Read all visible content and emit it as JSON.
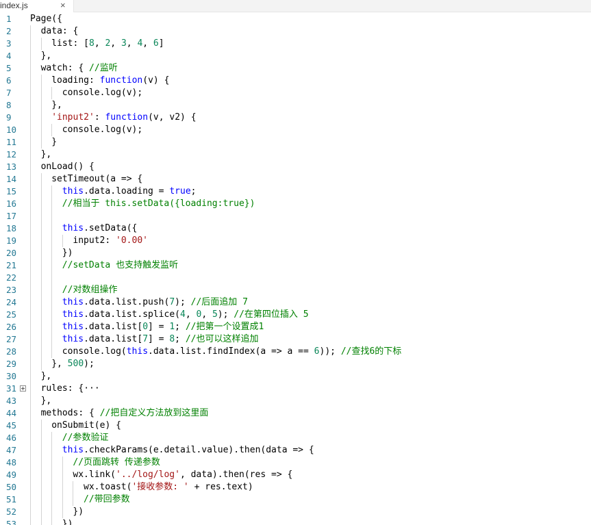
{
  "tab": {
    "title": "index.js",
    "close": "×"
  },
  "editor": {
    "fold_marker": "fold-expand-icon",
    "colors": {
      "keyword": "#0000ff",
      "comment": "#008000",
      "string": "#a31515",
      "number": "#098658",
      "linenumber": "#237893"
    },
    "lines": [
      {
        "n": "1",
        "indent": 0,
        "tokens": [
          [
            "Page({",
            ""
          ]
        ]
      },
      {
        "n": "2",
        "indent": 1,
        "tokens": [
          [
            "data: {",
            ""
          ]
        ]
      },
      {
        "n": "3",
        "indent": 2,
        "tokens": [
          [
            "list: [",
            ""
          ],
          [
            "8",
            "nm"
          ],
          [
            ", ",
            ""
          ],
          [
            "2",
            "nm"
          ],
          [
            ", ",
            ""
          ],
          [
            "3",
            "nm"
          ],
          [
            ", ",
            ""
          ],
          [
            "4",
            "nm"
          ],
          [
            ", ",
            ""
          ],
          [
            "6",
            "nm"
          ],
          [
            "]",
            ""
          ]
        ]
      },
      {
        "n": "4",
        "indent": 1,
        "tokens": [
          [
            "},",
            ""
          ]
        ]
      },
      {
        "n": "5",
        "indent": 1,
        "tokens": [
          [
            "watch: { ",
            ""
          ],
          [
            "//监听",
            "cm"
          ]
        ]
      },
      {
        "n": "6",
        "indent": 2,
        "tokens": [
          [
            "loading: ",
            ""
          ],
          [
            "function",
            "kw"
          ],
          [
            "(v) {",
            ""
          ]
        ]
      },
      {
        "n": "7",
        "indent": 3,
        "tokens": [
          [
            "console.log(v);",
            ""
          ]
        ]
      },
      {
        "n": "8",
        "indent": 2,
        "tokens": [
          [
            "},",
            ""
          ]
        ]
      },
      {
        "n": "9",
        "indent": 2,
        "tokens": [
          [
            "'input2'",
            "st"
          ],
          [
            ": ",
            ""
          ],
          [
            "function",
            "kw"
          ],
          [
            "(v, v2) {",
            ""
          ]
        ]
      },
      {
        "n": "10",
        "indent": 3,
        "tokens": [
          [
            "console.log(v);",
            ""
          ]
        ]
      },
      {
        "n": "11",
        "indent": 2,
        "tokens": [
          [
            "}",
            ""
          ]
        ]
      },
      {
        "n": "12",
        "indent": 1,
        "tokens": [
          [
            "},",
            ""
          ]
        ]
      },
      {
        "n": "13",
        "indent": 1,
        "tokens": [
          [
            "onLoad() {",
            ""
          ]
        ]
      },
      {
        "n": "14",
        "indent": 2,
        "tokens": [
          [
            "setTimeout(a => {",
            ""
          ]
        ]
      },
      {
        "n": "15",
        "indent": 3,
        "tokens": [
          [
            "this",
            "kw"
          ],
          [
            ".data.loading = ",
            ""
          ],
          [
            "true",
            "kw"
          ],
          [
            ";",
            ""
          ]
        ]
      },
      {
        "n": "16",
        "indent": 3,
        "tokens": [
          [
            "//相当于 this.setData({loading:true})",
            "cm"
          ]
        ]
      },
      {
        "n": "17",
        "indent": 3,
        "tokens": []
      },
      {
        "n": "18",
        "indent": 3,
        "tokens": [
          [
            "this",
            "kw"
          ],
          [
            ".setData({",
            ""
          ]
        ]
      },
      {
        "n": "19",
        "indent": 4,
        "tokens": [
          [
            "input2: ",
            ""
          ],
          [
            "'0.00'",
            "st"
          ]
        ]
      },
      {
        "n": "20",
        "indent": 3,
        "tokens": [
          [
            "})",
            ""
          ]
        ]
      },
      {
        "n": "21",
        "indent": 3,
        "tokens": [
          [
            "//setData 也支持触发监听",
            "cm"
          ]
        ]
      },
      {
        "n": "22",
        "indent": 3,
        "tokens": []
      },
      {
        "n": "23",
        "indent": 3,
        "tokens": [
          [
            "//对数组操作",
            "cm"
          ]
        ]
      },
      {
        "n": "24",
        "indent": 3,
        "tokens": [
          [
            "this",
            "kw"
          ],
          [
            ".data.list.push(",
            ""
          ],
          [
            "7",
            "nm"
          ],
          [
            "); ",
            ""
          ],
          [
            "//后面追加 7",
            "cm"
          ]
        ]
      },
      {
        "n": "25",
        "indent": 3,
        "tokens": [
          [
            "this",
            "kw"
          ],
          [
            ".data.list.splice(",
            ""
          ],
          [
            "4",
            "nm"
          ],
          [
            ", ",
            ""
          ],
          [
            "0",
            "nm"
          ],
          [
            ", ",
            ""
          ],
          [
            "5",
            "nm"
          ],
          [
            "); ",
            ""
          ],
          [
            "//在第四位插入 5",
            "cm"
          ]
        ]
      },
      {
        "n": "26",
        "indent": 3,
        "tokens": [
          [
            "this",
            "kw"
          ],
          [
            ".data.list[",
            ""
          ],
          [
            "0",
            "nm"
          ],
          [
            "] = ",
            ""
          ],
          [
            "1",
            "nm"
          ],
          [
            "; ",
            ""
          ],
          [
            "//把第一个设置成1",
            "cm"
          ]
        ]
      },
      {
        "n": "27",
        "indent": 3,
        "tokens": [
          [
            "this",
            "kw"
          ],
          [
            ".data.list[",
            ""
          ],
          [
            "7",
            "nm"
          ],
          [
            "] = ",
            ""
          ],
          [
            "8",
            "nm"
          ],
          [
            "; ",
            ""
          ],
          [
            "//也可以这样追加",
            "cm"
          ]
        ]
      },
      {
        "n": "28",
        "indent": 3,
        "tokens": [
          [
            "console.log(",
            ""
          ],
          [
            "this",
            "kw"
          ],
          [
            ".data.list.findIndex(a => a == ",
            ""
          ],
          [
            "6",
            "nm"
          ],
          [
            ")); ",
            ""
          ],
          [
            "//查找6的下标",
            "cm"
          ]
        ]
      },
      {
        "n": "29",
        "indent": 2,
        "tokens": [
          [
            "}, ",
            ""
          ],
          [
            "500",
            "nm"
          ],
          [
            ");",
            ""
          ]
        ]
      },
      {
        "n": "30",
        "indent": 1,
        "tokens": [
          [
            "},",
            ""
          ]
        ]
      },
      {
        "n": "31",
        "indent": 1,
        "fold": true,
        "tokens": [
          [
            "rules: {···",
            ""
          ]
        ]
      },
      {
        "n": "43",
        "indent": 1,
        "tokens": [
          [
            "},",
            ""
          ]
        ]
      },
      {
        "n": "44",
        "indent": 1,
        "tokens": [
          [
            "methods: { ",
            ""
          ],
          [
            "//把自定义方法放到这里面",
            "cm"
          ]
        ]
      },
      {
        "n": "45",
        "indent": 2,
        "tokens": [
          [
            "onSubmit(e) {",
            ""
          ]
        ]
      },
      {
        "n": "46",
        "indent": 3,
        "tokens": [
          [
            "//参数验证",
            "cm"
          ]
        ]
      },
      {
        "n": "47",
        "indent": 3,
        "tokens": [
          [
            "this",
            "kw"
          ],
          [
            ".checkParams(e.detail.value).then(data => {",
            ""
          ]
        ]
      },
      {
        "n": "48",
        "indent": 4,
        "tokens": [
          [
            "//页面跳转 传递参数",
            "cm"
          ]
        ]
      },
      {
        "n": "49",
        "indent": 4,
        "tokens": [
          [
            "wx.link(",
            ""
          ],
          [
            "'../log/log'",
            "st"
          ],
          [
            ", data).then(res => {",
            ""
          ]
        ]
      },
      {
        "n": "50",
        "indent": 5,
        "tokens": [
          [
            "wx.toast(",
            ""
          ],
          [
            "'接收参数: '",
            "st"
          ],
          [
            " + res.text)",
            ""
          ]
        ]
      },
      {
        "n": "51",
        "indent": 5,
        "tokens": [
          [
            "//带回参数",
            "cm"
          ]
        ]
      },
      {
        "n": "52",
        "indent": 4,
        "tokens": [
          [
            "})",
            ""
          ]
        ]
      },
      {
        "n": "53",
        "indent": 3,
        "tokens": [
          [
            "})",
            ""
          ]
        ]
      }
    ]
  }
}
